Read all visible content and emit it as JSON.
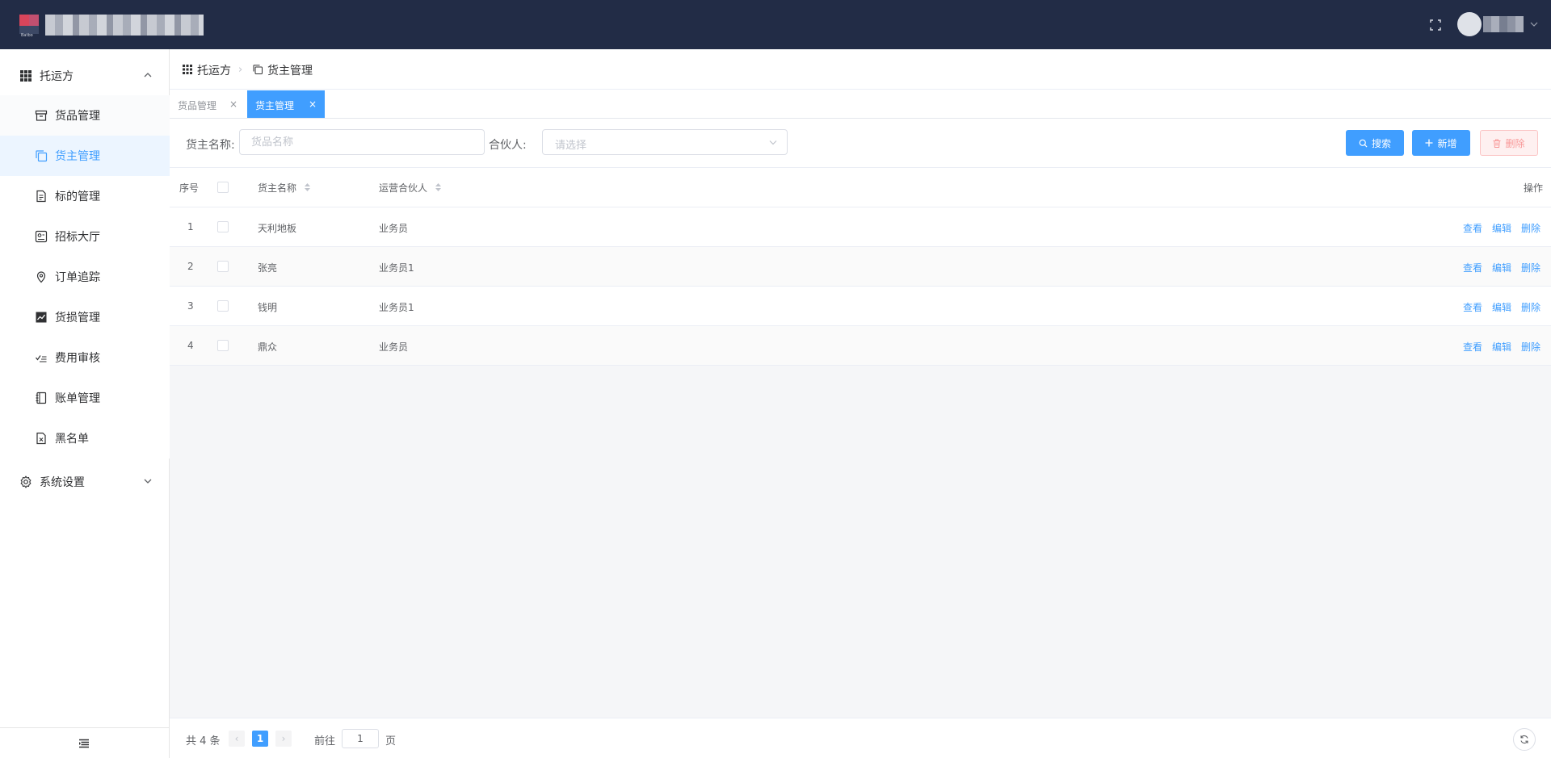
{
  "header": {
    "logo_text": "Batbo"
  },
  "sidebar": {
    "group1": {
      "label": "托运方",
      "icon": "grid-icon"
    },
    "items": [
      {
        "label": "货品管理",
        "icon": "archive-icon"
      },
      {
        "label": "货主管理",
        "icon": "copy-icon"
      },
      {
        "label": "标的管理",
        "icon": "document-icon"
      },
      {
        "label": "招标大厅",
        "icon": "ticket-icon"
      },
      {
        "label": "订单追踪",
        "icon": "location-icon"
      },
      {
        "label": "货损管理",
        "icon": "chart-line-icon"
      },
      {
        "label": "费用审核",
        "icon": "checklist-icon"
      },
      {
        "label": "账单管理",
        "icon": "notebook-icon"
      },
      {
        "label": "黑名单",
        "icon": "document-x-icon"
      }
    ],
    "group2": {
      "label": "系统设置",
      "icon": "gear-icon"
    }
  },
  "breadcrumb": {
    "root": "托运方",
    "current": "货主管理"
  },
  "tabs": [
    {
      "label": "货品管理",
      "close": "×"
    },
    {
      "label": "货主管理",
      "close": "×"
    }
  ],
  "filters": {
    "owner_label": "货主名称:",
    "owner_placeholder": "货品名称",
    "partner_label": "合伙人:",
    "partner_placeholder": "请选择",
    "search_label": "搜索",
    "add_label": "新增",
    "delete_label": "删除"
  },
  "table": {
    "headers": {
      "index": "序号",
      "name": "货主名称",
      "partner": "运营合伙人",
      "ops": "操作"
    },
    "rows": [
      {
        "index": "1",
        "name": "天利地板",
        "partner": "业务员"
      },
      {
        "index": "2",
        "name": "张亮",
        "partner": "业务员1"
      },
      {
        "index": "3",
        "name": "钱明",
        "partner": "业务员1"
      },
      {
        "index": "4",
        "name": "鼎众",
        "partner": "业务员"
      }
    ],
    "actions": {
      "view": "查看",
      "edit": "编辑",
      "delete": "删除"
    }
  },
  "pagination": {
    "total": "共 4 条",
    "current": "1",
    "goto_label": "前往",
    "goto_value": "1",
    "page_suffix": "页"
  },
  "colors": {
    "header_bg": "#222c46",
    "primary": "#409eff",
    "danger_bg": "#fef0f0"
  }
}
